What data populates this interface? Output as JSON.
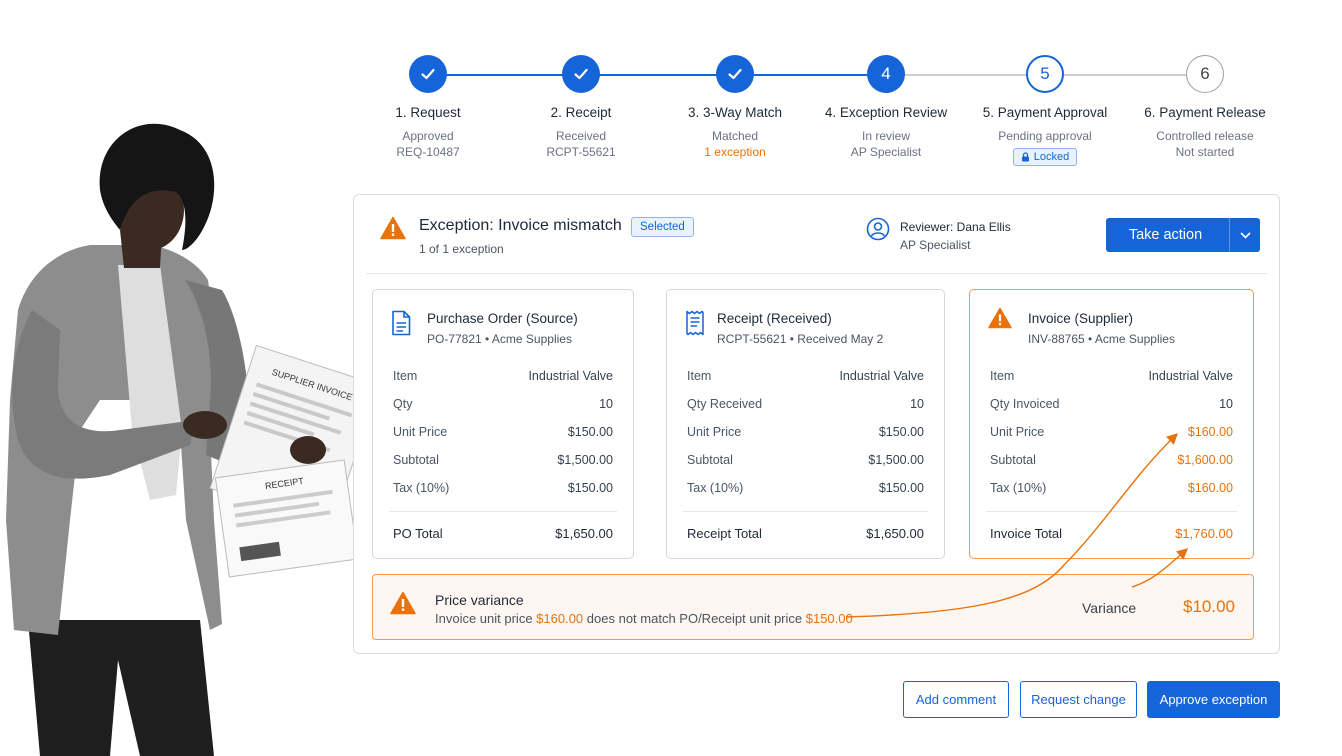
{
  "colors": {
    "accent": "#1565d8",
    "warning": "#e8720c",
    "warning_bg": "#fef6f0"
  },
  "steps": [
    {
      "number": "",
      "title": "1. Request",
      "line1": "Approved",
      "line2": "REQ-10487",
      "state": "done"
    },
    {
      "number": "",
      "title": "2. Receipt",
      "line1": "Received",
      "line2": "RCPT-55621",
      "state": "done"
    },
    {
      "number": "",
      "title": "3. 3-Way Match",
      "line1": "Matched",
      "line2": "1 exception",
      "state": "done"
    },
    {
      "number": "4",
      "title": "4. Exception Review",
      "line1": "In review",
      "line2": "AP Specialist",
      "state": "current"
    },
    {
      "number": "5",
      "title": "5. Payment Approval",
      "line1": "Pending approval",
      "badge": "Locked",
      "state": "upcoming"
    },
    {
      "number": "6",
      "title": "6. Payment Release",
      "line1": "Controlled release",
      "line2": "Not started",
      "state": "future"
    }
  ],
  "exception": {
    "title": "Exception: Invoice mismatch",
    "count": "1 of 1 exception",
    "badge": "Selected",
    "reviewer_name": "Reviewer: Dana Ellis",
    "reviewer_role": "AP Specialist",
    "action_label": "Take action"
  },
  "cards": [
    {
      "title": "Purchase Order (Source)",
      "sub": "PO-77821  •  Acme Supplies",
      "icon": "document-icon",
      "rows": [
        {
          "k": "Item",
          "v": "Industrial Valve"
        },
        {
          "k": "Qty",
          "v": "10"
        },
        {
          "k": "Unit Price",
          "v": "$150.00"
        },
        {
          "k": "Subtotal",
          "v": "$1,500.00"
        },
        {
          "k": "Tax (10%)",
          "v": "$150.00"
        }
      ],
      "total_label": "PO Total",
      "total_value": "$1,650.00"
    },
    {
      "title": "Receipt (Received)",
      "sub": "RCPT-55621  •  Received May 2",
      "icon": "receipt-icon",
      "rows": [
        {
          "k": "Item",
          "v": "Industrial Valve"
        },
        {
          "k": "Qty Received",
          "v": "10"
        },
        {
          "k": "Unit Price",
          "v": "$150.00"
        },
        {
          "k": "Subtotal",
          "v": "$1,500.00"
        },
        {
          "k": "Tax (10%)",
          "v": "$150.00"
        }
      ],
      "total_label": "Receipt Total",
      "total_value": "$1,650.00"
    },
    {
      "title": "Invoice (Supplier)",
      "sub": "INV-88765  •  Acme Supplies",
      "icon": "warning-icon",
      "rows": [
        {
          "k": "Item",
          "v": "Industrial Valve"
        },
        {
          "k": "Qty Invoiced",
          "v": "10"
        },
        {
          "k": "Unit Price",
          "v": "$160.00"
        },
        {
          "k": "Subtotal",
          "v": "$1,600.00"
        },
        {
          "k": "Tax (10%)",
          "v": "$160.00"
        }
      ],
      "total_label": "Invoice Total",
      "total_value": "$1,760.00"
    }
  ],
  "variance": {
    "title": "Price variance",
    "desc_1": "Invoice unit price ",
    "desc_price_invoice": "$160.00",
    "desc_2": " does not match PO/Receipt unit price ",
    "desc_price_po": "$150.00",
    "label": "Variance",
    "value": "$10.00"
  },
  "actions": {
    "add_comment": "Add comment",
    "request_change": "Request change",
    "approve": "Approve exception"
  },
  "illustration": {
    "paper_1": "SUPPLIER INVOICE",
    "paper_2": "RECEIPT"
  }
}
